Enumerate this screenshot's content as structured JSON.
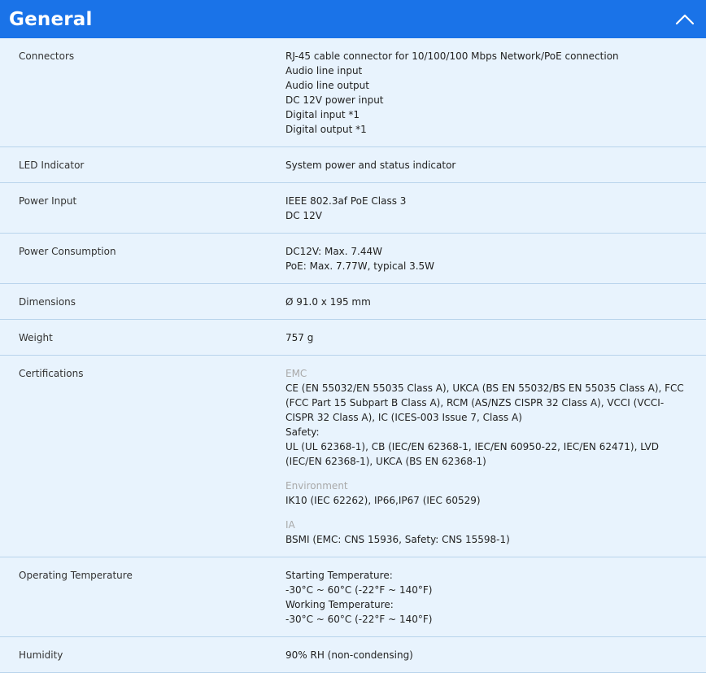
{
  "header": {
    "title": "General"
  },
  "specs": {
    "connectors": {
      "label": "Connectors",
      "lines": [
        "RJ-45 cable connector for 10/100/100 Mbps Network/PoE connection",
        "Audio line input",
        "Audio line output",
        "DC 12V power input",
        "Digital input *1",
        "Digital output *1"
      ]
    },
    "led": {
      "label": "LED Indicator",
      "lines": [
        "System power and status indicator"
      ]
    },
    "power_input": {
      "label": "Power Input",
      "lines": [
        "IEEE 802.3af PoE Class 3",
        "DC 12V"
      ]
    },
    "power_consumption": {
      "label": "Power Consumption",
      "lines": [
        "DC12V: Max. 7.44W",
        "PoE: Max. 7.77W, typical 3.5W"
      ]
    },
    "dimensions": {
      "label": "Dimensions",
      "lines": [
        "Ø 91.0 x 195 mm"
      ]
    },
    "weight": {
      "label": "Weight",
      "lines": [
        "757 g"
      ]
    },
    "certifications": {
      "label": "Certifications",
      "emc": {
        "heading": "EMC",
        "lines": [
          "CE (EN 55032/EN 55035 Class A), UKCA (BS EN 55032/BS EN 55035 Class A), FCC (FCC Part 15 Subpart B Class A), RCM (AS/NZS CISPR 32 Class A), VCCI (VCCI-CISPR 32 Class A), IC (ICES-003 Issue 7, Class A)",
          "Safety:",
          "UL (UL 62368-1), CB (IEC/EN 62368-1, IEC/EN 60950-22, IEC/EN 62471), LVD (IEC/EN 62368-1), UKCA (BS EN 62368-1)"
        ]
      },
      "environment": {
        "heading": "Environment",
        "lines": [
          "IK10 (IEC 62262), IP66,IP67 (IEC 60529)"
        ]
      },
      "ia": {
        "heading": "IA",
        "lines": [
          "BSMI (EMC: CNS 15936, Safety: CNS 15598-1)"
        ]
      }
    },
    "operating_temperature": {
      "label": "Operating Temperature",
      "lines": [
        "Starting Temperature:",
        "-30°C ~ 60°C (-22°F ~ 140°F)",
        "Working Temperature:",
        "-30°C ~ 60°C (-22°F ~ 140°F)"
      ]
    },
    "humidity": {
      "label": "Humidity",
      "lines": [
        "90% RH (non-condensing)"
      ]
    }
  },
  "icons": {
    "collapse": "chevron-up-icon"
  },
  "colors": {
    "header_bg": "#1a73e8",
    "page_bg": "#e8f3fd",
    "divider": "#b9d4ec",
    "muted_heading": "#a9a9a9"
  }
}
